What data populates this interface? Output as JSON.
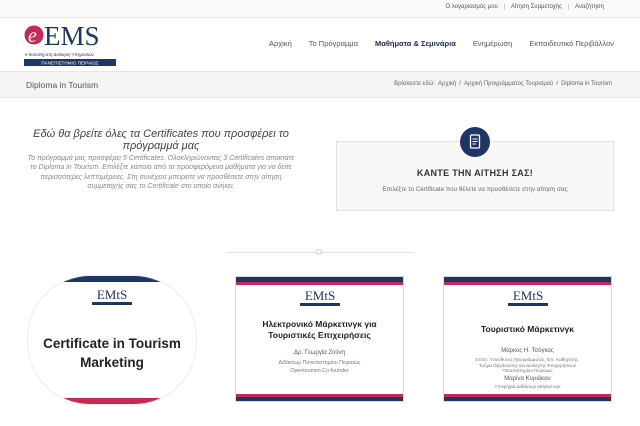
{
  "topbar": {
    "links": [
      "Ο λογαριασμός μου",
      "Αίτηση Συμμετοχής",
      "Αναζήτηση"
    ]
  },
  "logo": {
    "text": "EMS",
    "tagline": "e-learning στη Διοίκηση Υπηρεσιών",
    "university": "ΠΑΝΕΠΙΣΤΗΜΙΟ ΠΕΙΡΑΙΩΣ"
  },
  "nav": {
    "items": [
      "Αρχική",
      "Το Πρόγραμμα",
      "Μαθήματα & Σεμινάρια",
      "Ενημέρωση",
      "Εκπαιδευτικό Περιβάλλον"
    ],
    "active_index": 2
  },
  "page": {
    "title": "Diploma in Tourism",
    "breadcrumb_prefix": "Βρίσκεστε εδώ:",
    "breadcrumb": [
      "Αρχική",
      "Αρχική Προγράμματος Τουρισμού",
      "Diploma in Tourism"
    ]
  },
  "intro": {
    "heading": "Εδώ θα βρείτε όλες τα Certificates που προσφέρει το πρόγραμμά μας",
    "body": "Το πρόγραμμά μας προσφέρει 5 Certificates. Ολοκληρώνοντας 3 Certificates αποκτάτε το Diploma in Tourism. Επιλέξτε κάποιο από τα προσφερόμενα μαθήματα για να δείτε περισσότερες λεπτομέρειες. Στη συνέχεια μπορείτε να προσθέσετε στην αίτηση συμμετοχής σας το Certificate στο οποίο ανήκει."
  },
  "cta": {
    "title": "ΚΑΝΤΕ ΤΗΝ ΑΙΤΗΣΗ ΣΑΣ!",
    "text": "Επιλέξτε το Certificate που θέλετε να προσθέσετε στην αίτηση σας"
  },
  "cards": [
    {
      "logo": "EMtS",
      "title": "Certificate in Tourism Marketing"
    },
    {
      "logo": "EMtS",
      "title": "Ηλεκτρονικό Μάρκετινγκ για Τουριστικές Επιχειρήσεις",
      "person": "Δρ. Γεωργία Ζούνη",
      "lines": [
        "Διδάκτωρ Πανεπιστημίου Πειραιώς",
        "Opentourism Co-founder"
      ]
    },
    {
      "logo": "EMtS",
      "title": "Τουριστικό Μάρκετινγκ",
      "person": "Μάρκος Η. Τσόγκας",
      "lines": [
        "Επιστ. Υπεύθυνος Προγράμματος, Επ. Καθηγητής,",
        "Τμήμα Οργάνωσης και Διοίκησης Επιχειρήσεων",
        "Πανεπιστημίου Πειραιώς"
      ],
      "person2": "Μαρίνα Κυριάκου",
      "lines2": [
        "Υποψήφια Διδάκτωρ Μάρκετινγκ"
      ]
    }
  ],
  "colors": {
    "navy": "#1f3564",
    "crimson": "#c42a55",
    "nav_active": "#1e2a4f"
  }
}
